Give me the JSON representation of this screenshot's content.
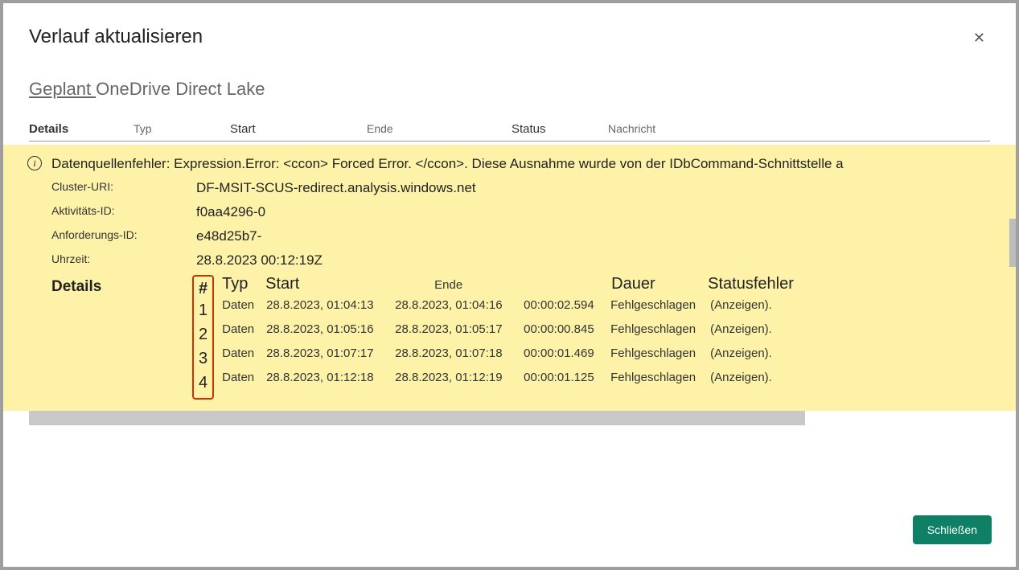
{
  "dialog": {
    "title": "Verlauf aktualisieren",
    "close_x": "✕"
  },
  "page": {
    "link": "Geplant ",
    "rest": "OneDrive Direct Lake"
  },
  "cols": {
    "details": "Details",
    "typ": "Typ",
    "start": "Start",
    "ende": "Ende",
    "status": "Status",
    "nachricht": "Nachricht"
  },
  "error": {
    "info_icon": "i",
    "message": "Datenquellenfehler: Expression.Error: <ccon> Forced Error. </ccon>. Diese Ausnahme wurde von der IDbCommand-Schnittstelle a",
    "meta": {
      "cluster_label": "Cluster-URI:",
      "cluster_value": "DF-MSIT-SCUS-redirect.analysis.windows.net",
      "activity_label": "Aktivitäts-ID:",
      "activity_value": "f0aa4296-0",
      "request_label": "Anforderungs-ID:",
      "request_value": "e48d25b7-",
      "time_label": "Uhrzeit:",
      "time_value": "28.8.2023 00:12:19Z"
    }
  },
  "attempts": {
    "details_label": "Details",
    "head": {
      "num": "#",
      "typ": "Typ",
      "start": "Start",
      "ende": "Ende",
      "dauer": "Dauer",
      "statusfehler": "Statusfehler"
    },
    "rows": [
      {
        "n": "1",
        "typ": "Daten",
        "start": "28.8.2023, 01:04:13",
        "ende": "28.8.2023, 01:04:16",
        "dauer": "00:00:02.594",
        "status": "Fehlgeschlagen",
        "link": "(Anzeigen)."
      },
      {
        "n": "2",
        "typ": "Daten",
        "start": "28.8.2023, 01:05:16",
        "ende": "28.8.2023, 01:05:17",
        "dauer": "00:00:00.845",
        "status": "Fehlgeschlagen",
        "link": "(Anzeigen)."
      },
      {
        "n": "3",
        "typ": "Daten",
        "start": "28.8.2023, 01:07:17",
        "ende": "28.8.2023, 01:07:18",
        "dauer": "00:00:01.469",
        "status": "Fehlgeschlagen",
        "link": "(Anzeigen)."
      },
      {
        "n": "4",
        "typ": "Daten",
        "start": "28.8.2023, 01:12:18",
        "ende": "28.8.2023, 01:12:19",
        "dauer": "00:00:01.125",
        "status": "Fehlgeschlagen",
        "link": "(Anzeigen)."
      }
    ]
  },
  "footer": {
    "close": "Schließen"
  }
}
